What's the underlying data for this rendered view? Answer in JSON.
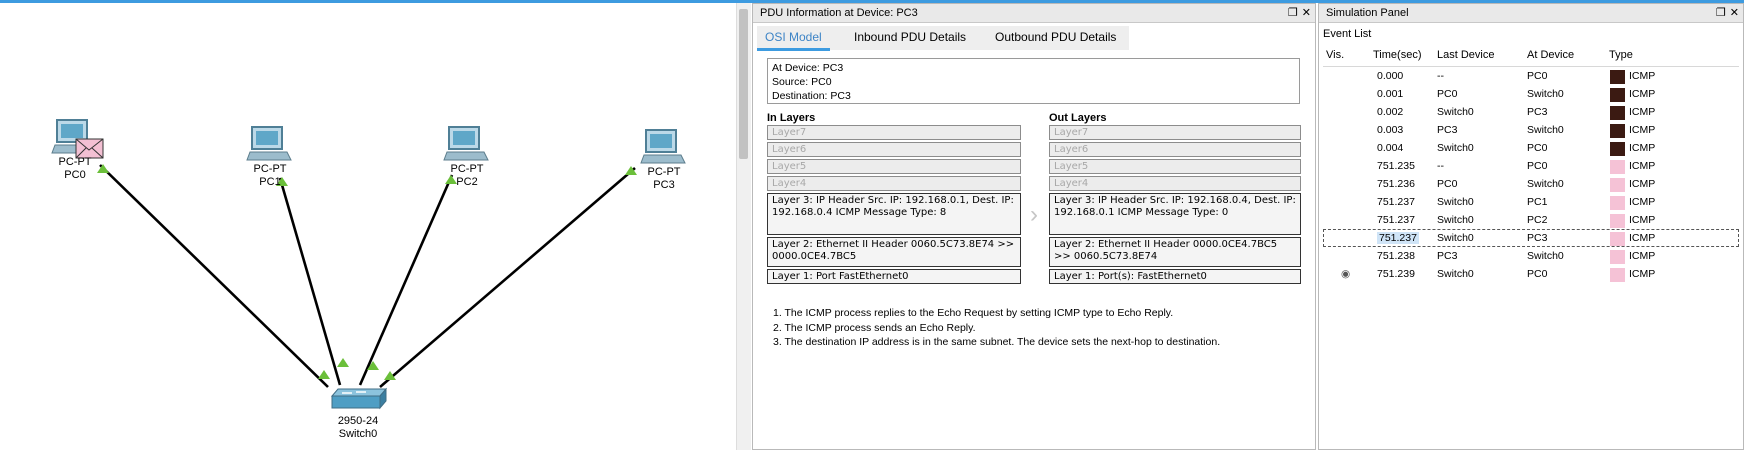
{
  "workspace": {
    "devices": [
      {
        "type": "PC-PT",
        "name": "PC0"
      },
      {
        "type": "PC-PT",
        "name": "PC1"
      },
      {
        "type": "PC-PT",
        "name": "PC2"
      },
      {
        "type": "PC-PT",
        "name": "PC3"
      },
      {
        "type": "2950-24",
        "name": "Switch0"
      }
    ]
  },
  "pdu_panel": {
    "title": "PDU Information at Device: PC3",
    "tabs": [
      "OSI Model",
      "Inbound PDU Details",
      "Outbound PDU Details"
    ],
    "info": {
      "at_device": "At Device: PC3",
      "source": "Source: PC0",
      "destination": "Destination: PC3"
    },
    "in_layers": {
      "title": "In Layers",
      "layers": [
        "Layer7",
        "Layer6",
        "Layer5",
        "Layer4",
        "Layer 3: IP Header Src. IP: 192.168.0.1, Dest. IP: 192.168.0.4 ICMP Message Type: 8",
        "Layer 2: Ethernet II Header 0060.5C73.8E74 >> 0000.0CE4.7BC5",
        "Layer 1: Port FastEthernet0"
      ]
    },
    "out_layers": {
      "title": "Out Layers",
      "layers": [
        "Layer7",
        "Layer6",
        "Layer5",
        "Layer4",
        "Layer 3: IP Header Src. IP: 192.168.0.4, Dest. IP: 192.168.0.1 ICMP Message Type: 0",
        "Layer 2: Ethernet II Header 0000.0CE4.7BC5 >> 0060.5C73.8E74",
        "Layer 1: Port(s): FastEthernet0"
      ]
    },
    "notes": [
      "1. The ICMP process replies to the Echo Request by setting ICMP type to Echo Reply.",
      "2. The ICMP process sends an Echo Reply.",
      "3. The destination IP address is in the same subnet. The device sets the next-hop to destination."
    ]
  },
  "sim_panel": {
    "title": "Simulation Panel",
    "event_list_label": "Event List",
    "columns": [
      "Vis.",
      "Time(sec)",
      "Last Device",
      "At Device",
      "Type"
    ],
    "events": [
      {
        "time": "0.000",
        "last": "--",
        "at": "PC0",
        "type": "ICMP",
        "color": "#3b1a12"
      },
      {
        "time": "0.001",
        "last": "PC0",
        "at": "Switch0",
        "type": "ICMP",
        "color": "#3b1a12"
      },
      {
        "time": "0.002",
        "last": "Switch0",
        "at": "PC3",
        "type": "ICMP",
        "color": "#3b1a12"
      },
      {
        "time": "0.003",
        "last": "PC3",
        "at": "Switch0",
        "type": "ICMP",
        "color": "#3b1a12"
      },
      {
        "time": "0.004",
        "last": "Switch0",
        "at": "PC0",
        "type": "ICMP",
        "color": "#3b1a12"
      },
      {
        "time": "751.235",
        "last": "--",
        "at": "PC0",
        "type": "ICMP",
        "color": "#f5c2d6"
      },
      {
        "time": "751.236",
        "last": "PC0",
        "at": "Switch0",
        "type": "ICMP",
        "color": "#f5c2d6"
      },
      {
        "time": "751.237",
        "last": "Switch0",
        "at": "PC1",
        "type": "ICMP",
        "color": "#f5c2d6"
      },
      {
        "time": "751.237",
        "last": "Switch0",
        "at": "PC2",
        "type": "ICMP",
        "color": "#f5c2d6"
      },
      {
        "time": "751.237",
        "last": "Switch0",
        "at": "PC3",
        "type": "ICMP",
        "color": "#f5c2d6"
      },
      {
        "time": "751.238",
        "last": "PC3",
        "at": "Switch0",
        "type": "ICMP",
        "color": "#f5c2d6"
      },
      {
        "time": "751.239",
        "last": "Switch0",
        "at": "PC0",
        "type": "ICMP",
        "color": "#f5c2d6"
      }
    ],
    "selected_index": 9,
    "visible_index": 11
  },
  "colors": {
    "accent": "#3d9be0",
    "link_green": "#6bbf3a",
    "device_blue": "#4f9ec4"
  }
}
